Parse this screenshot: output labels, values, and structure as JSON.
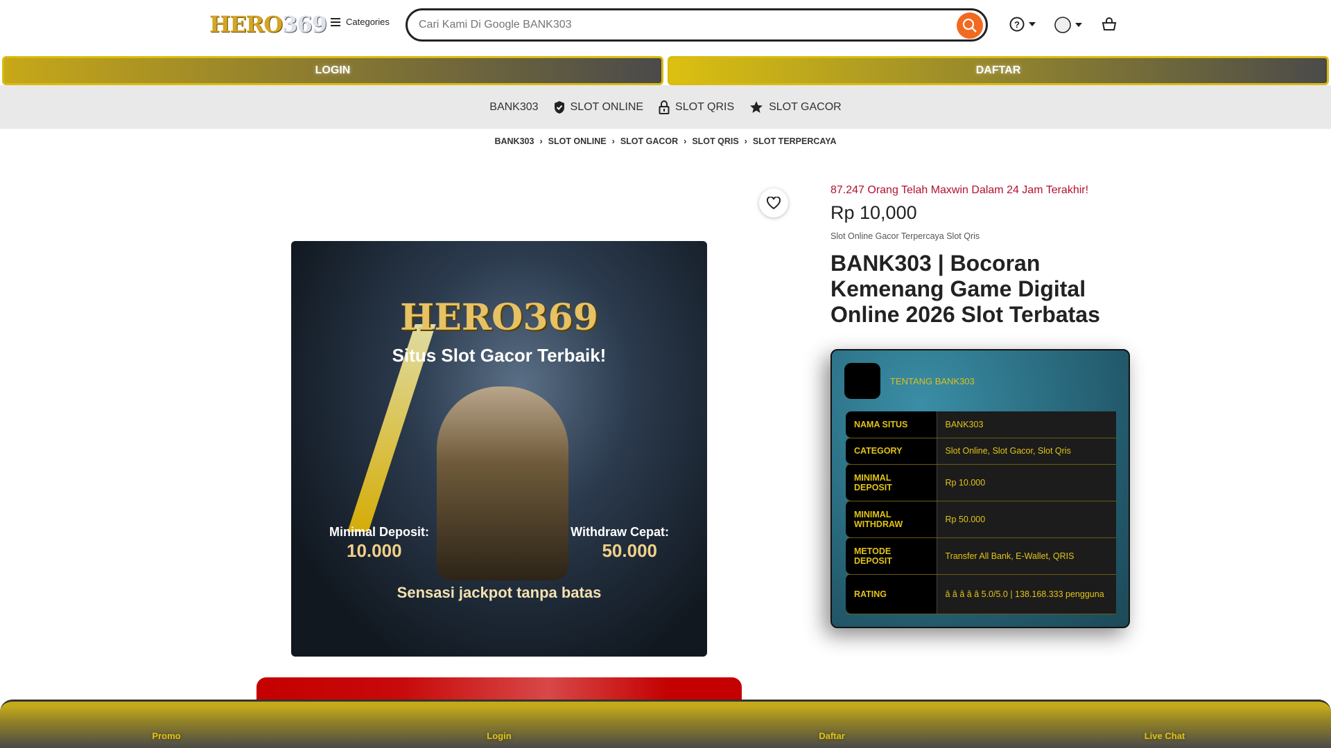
{
  "header": {
    "logo_a": "HERO",
    "logo_b": "369",
    "categories": "Categories",
    "search_placeholder": "Cari Kami Di Google BANK303"
  },
  "auth": {
    "login": "LOGIN",
    "daftar": "DAFTAR"
  },
  "nav": [
    "BANK303",
    "SLOT ONLINE",
    "SLOT QRIS",
    "SLOT GACOR"
  ],
  "breadcrumb": [
    "BANK303",
    "SLOT ONLINE",
    "SLOT GACOR",
    "SLOT QRIS",
    "SLOT TERPERCAYA"
  ],
  "image": {
    "brand": "HERO369",
    "tagline": "Situs Slot Gacor Terbaik!",
    "min_deposit_label": "Minimal Deposit:",
    "min_deposit": "10.000",
    "withdraw_label": "Withdraw Cepat:",
    "withdraw": "50.000",
    "slogan": "Sensasi jackpot tanpa batas"
  },
  "product": {
    "maxwin": "87.247 Orang Telah Maxwin Dalam 24 Jam Terakhir!",
    "price": "Rp 10,000",
    "subtitle": "Slot Online Gacor Terpercaya Slot Qris",
    "title": "BANK303 | Bocoran Kemenang Game Digital Online 2026 Slot Terbatas"
  },
  "card": {
    "about": "TENTANG BANK303",
    "rows": [
      {
        "label": "NAMA SITUS",
        "value": "BANK303"
      },
      {
        "label": "CATEGORY",
        "value": "Slot Online, Slot Gacor, Slot Qris"
      },
      {
        "label": "MINIMAL DEPOSIT",
        "value": "Rp 10.000"
      },
      {
        "label": "MINIMAL WITHDRAW",
        "value": "Rp 50.000"
      },
      {
        "label": "METODE DEPOSIT",
        "value": "Transfer All Bank, E-Wallet, QRIS"
      },
      {
        "label": "RATING",
        "value": "â   â   â   â   â    5.0/5.0 | 138.168.333 pengguna"
      }
    ]
  },
  "bottom_nav": [
    "Promo",
    "Login",
    "Daftar",
    "Live Chat"
  ],
  "colors": {
    "accent": "#f26a21",
    "gold": "#e2c417",
    "red": "#c40000"
  }
}
